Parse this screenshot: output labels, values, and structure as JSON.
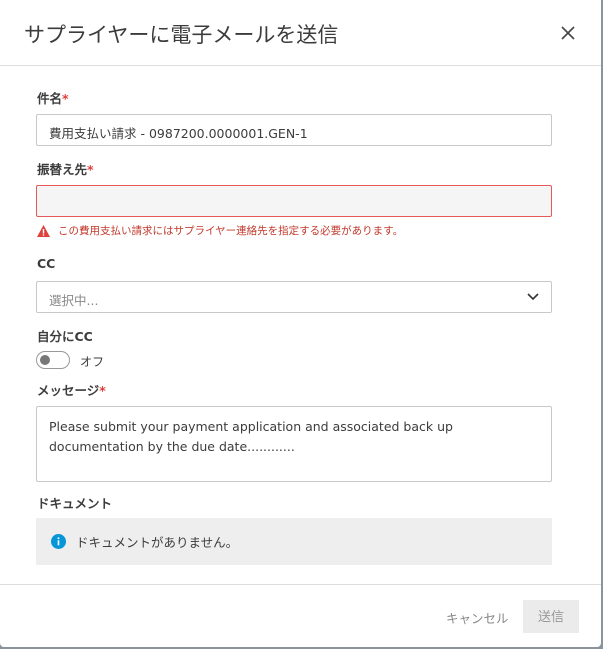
{
  "dialog": {
    "title": "サプライヤーに電子メールを送信"
  },
  "subject": {
    "label": "件名",
    "required": "*",
    "value": "費用支払い請求 - 0987200.0000001.GEN-1"
  },
  "to": {
    "label": "振替え先",
    "required": "*",
    "value": "",
    "error": "この費用支払い請求にはサプライヤー連絡先を指定する必要があります。"
  },
  "cc": {
    "label": "CC",
    "placeholder": "選択中..."
  },
  "cc_self": {
    "label": "自分にCC",
    "state": "オフ"
  },
  "message": {
    "label": "メッセージ",
    "required": "*",
    "value": "Please submit your payment application and associated back up documentation by the due date............"
  },
  "documents": {
    "label": "ドキュメント",
    "empty": "ドキュメントがありません。"
  },
  "footer": {
    "cancel": "キャンセル",
    "send": "送信"
  },
  "colors": {
    "error": "#e0403c",
    "info": "#0696d7"
  }
}
